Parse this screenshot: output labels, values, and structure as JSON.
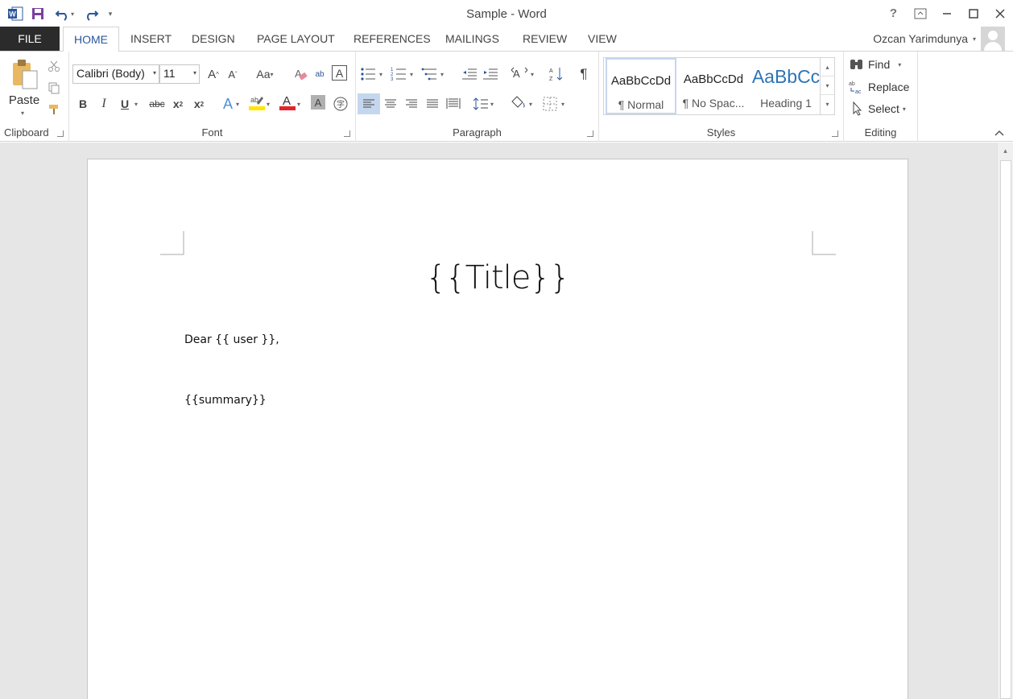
{
  "window": {
    "title": "Sample - Word",
    "help": "?"
  },
  "qat": {
    "app_icon": "word-app-icon",
    "save": "save-icon",
    "undo": "undo-icon",
    "redo": "redo-icon",
    "customize": "customize-qat-icon"
  },
  "tabs": {
    "file": "FILE",
    "items": [
      "HOME",
      "INSERT",
      "DESIGN",
      "PAGE LAYOUT",
      "REFERENCES",
      "MAILINGS",
      "REVIEW",
      "VIEW"
    ]
  },
  "user": {
    "name": "Ozcan Yarimdunya"
  },
  "ribbon": {
    "clipboard": {
      "label": "Clipboard",
      "paste": "Paste"
    },
    "font": {
      "label": "Font",
      "font_name": "Calibri (Body)",
      "font_size": "11",
      "change_case": "Aa",
      "bold": "B",
      "italic": "I",
      "underline": "U",
      "strikethrough": "abc",
      "subscript": "x",
      "superscript": "x",
      "font_color_accent": "#e3242b",
      "highlight_accent": "#ffe600"
    },
    "paragraph": {
      "label": "Paragraph",
      "pilcrow": "¶"
    },
    "styles": {
      "label": "Styles",
      "items": [
        {
          "sample": "AaBbCcDd",
          "name": "¶ Normal"
        },
        {
          "sample": "AaBbCcDd",
          "name": "¶ No Spac..."
        },
        {
          "sample": "AaBbCc",
          "name": "Heading 1"
        }
      ],
      "heading_color": "#2e74b5"
    },
    "editing": {
      "label": "Editing",
      "find": "Find",
      "replace": "Replace",
      "select": "Select"
    }
  },
  "document": {
    "title": "{{Title}}",
    "greeting": "Dear {{ user }},",
    "summary": "{{summary}}"
  }
}
